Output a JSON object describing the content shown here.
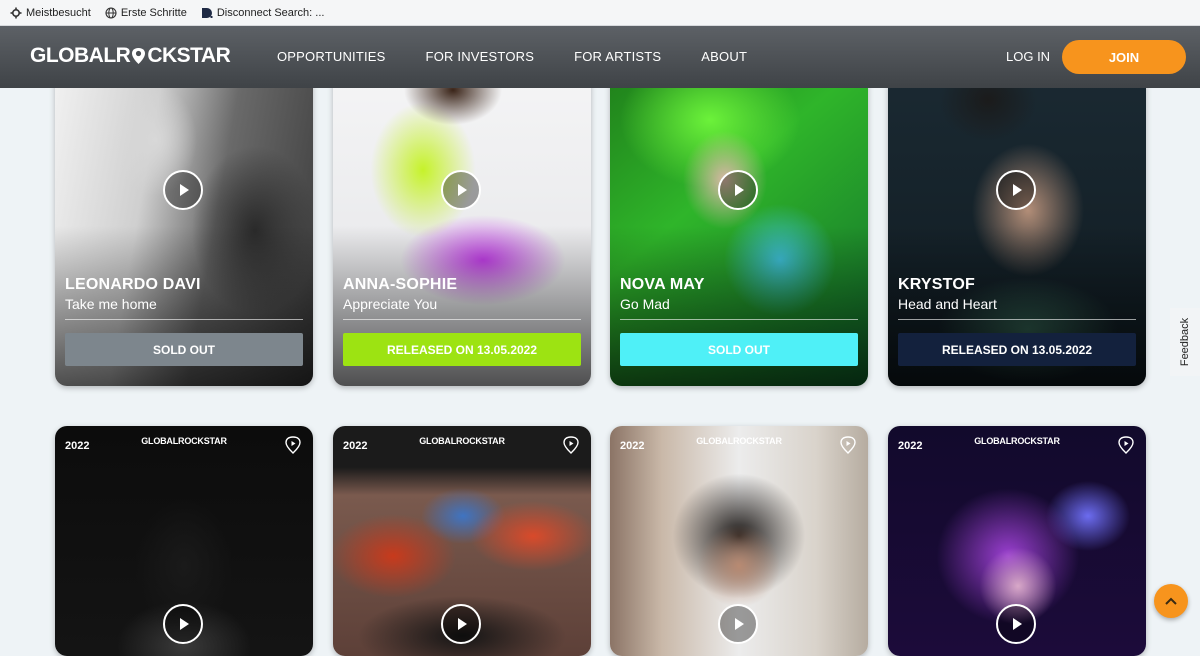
{
  "bookmarks": [
    {
      "label": "Meistbesucht",
      "icon": "gear-icon"
    },
    {
      "label": "Erste Schritte",
      "icon": "globe-icon"
    },
    {
      "label": "Disconnect Search: ...",
      "icon": "disconnect-icon"
    }
  ],
  "nav": {
    "logo_left": "GLOBALR",
    "logo_right": "CKSTAR",
    "links": [
      "OPPORTUNITIES",
      "FOR INVESTORS",
      "FOR ARTISTS",
      "ABOUT"
    ],
    "login": "LOG IN",
    "join": "JOIN"
  },
  "colors": {
    "accent": "#f7941d",
    "sold_out_grey": "#7d868d",
    "lime": "#9de312",
    "cyan": "#4ff0f7",
    "navy": "#13213d"
  },
  "cards_top": [
    {
      "artist": "LEONARDO DAVI",
      "song": "Take me home",
      "status": "SOLD OUT"
    },
    {
      "artist": "ANNA-SOPHIE",
      "song": "Appreciate You",
      "status": "RELEASED ON 13.05.2022"
    },
    {
      "artist": "NOVA MAY",
      "song": "Go Mad",
      "status": "SOLD OUT"
    },
    {
      "artist": "KRYSTOF",
      "song": "Head and Heart",
      "status": "RELEASED ON 13.05.2022"
    }
  ],
  "cards_bottom": [
    {
      "year": "2022",
      "brand": "GLOBALROCKSTAR"
    },
    {
      "year": "2022",
      "brand": "GLOBALROCKSTAR"
    },
    {
      "year": "2022",
      "brand": "GLOBALROCKSTAR"
    },
    {
      "year": "2022",
      "brand": "GLOBALROCKSTAR"
    }
  ],
  "feedback": "Feedback"
}
